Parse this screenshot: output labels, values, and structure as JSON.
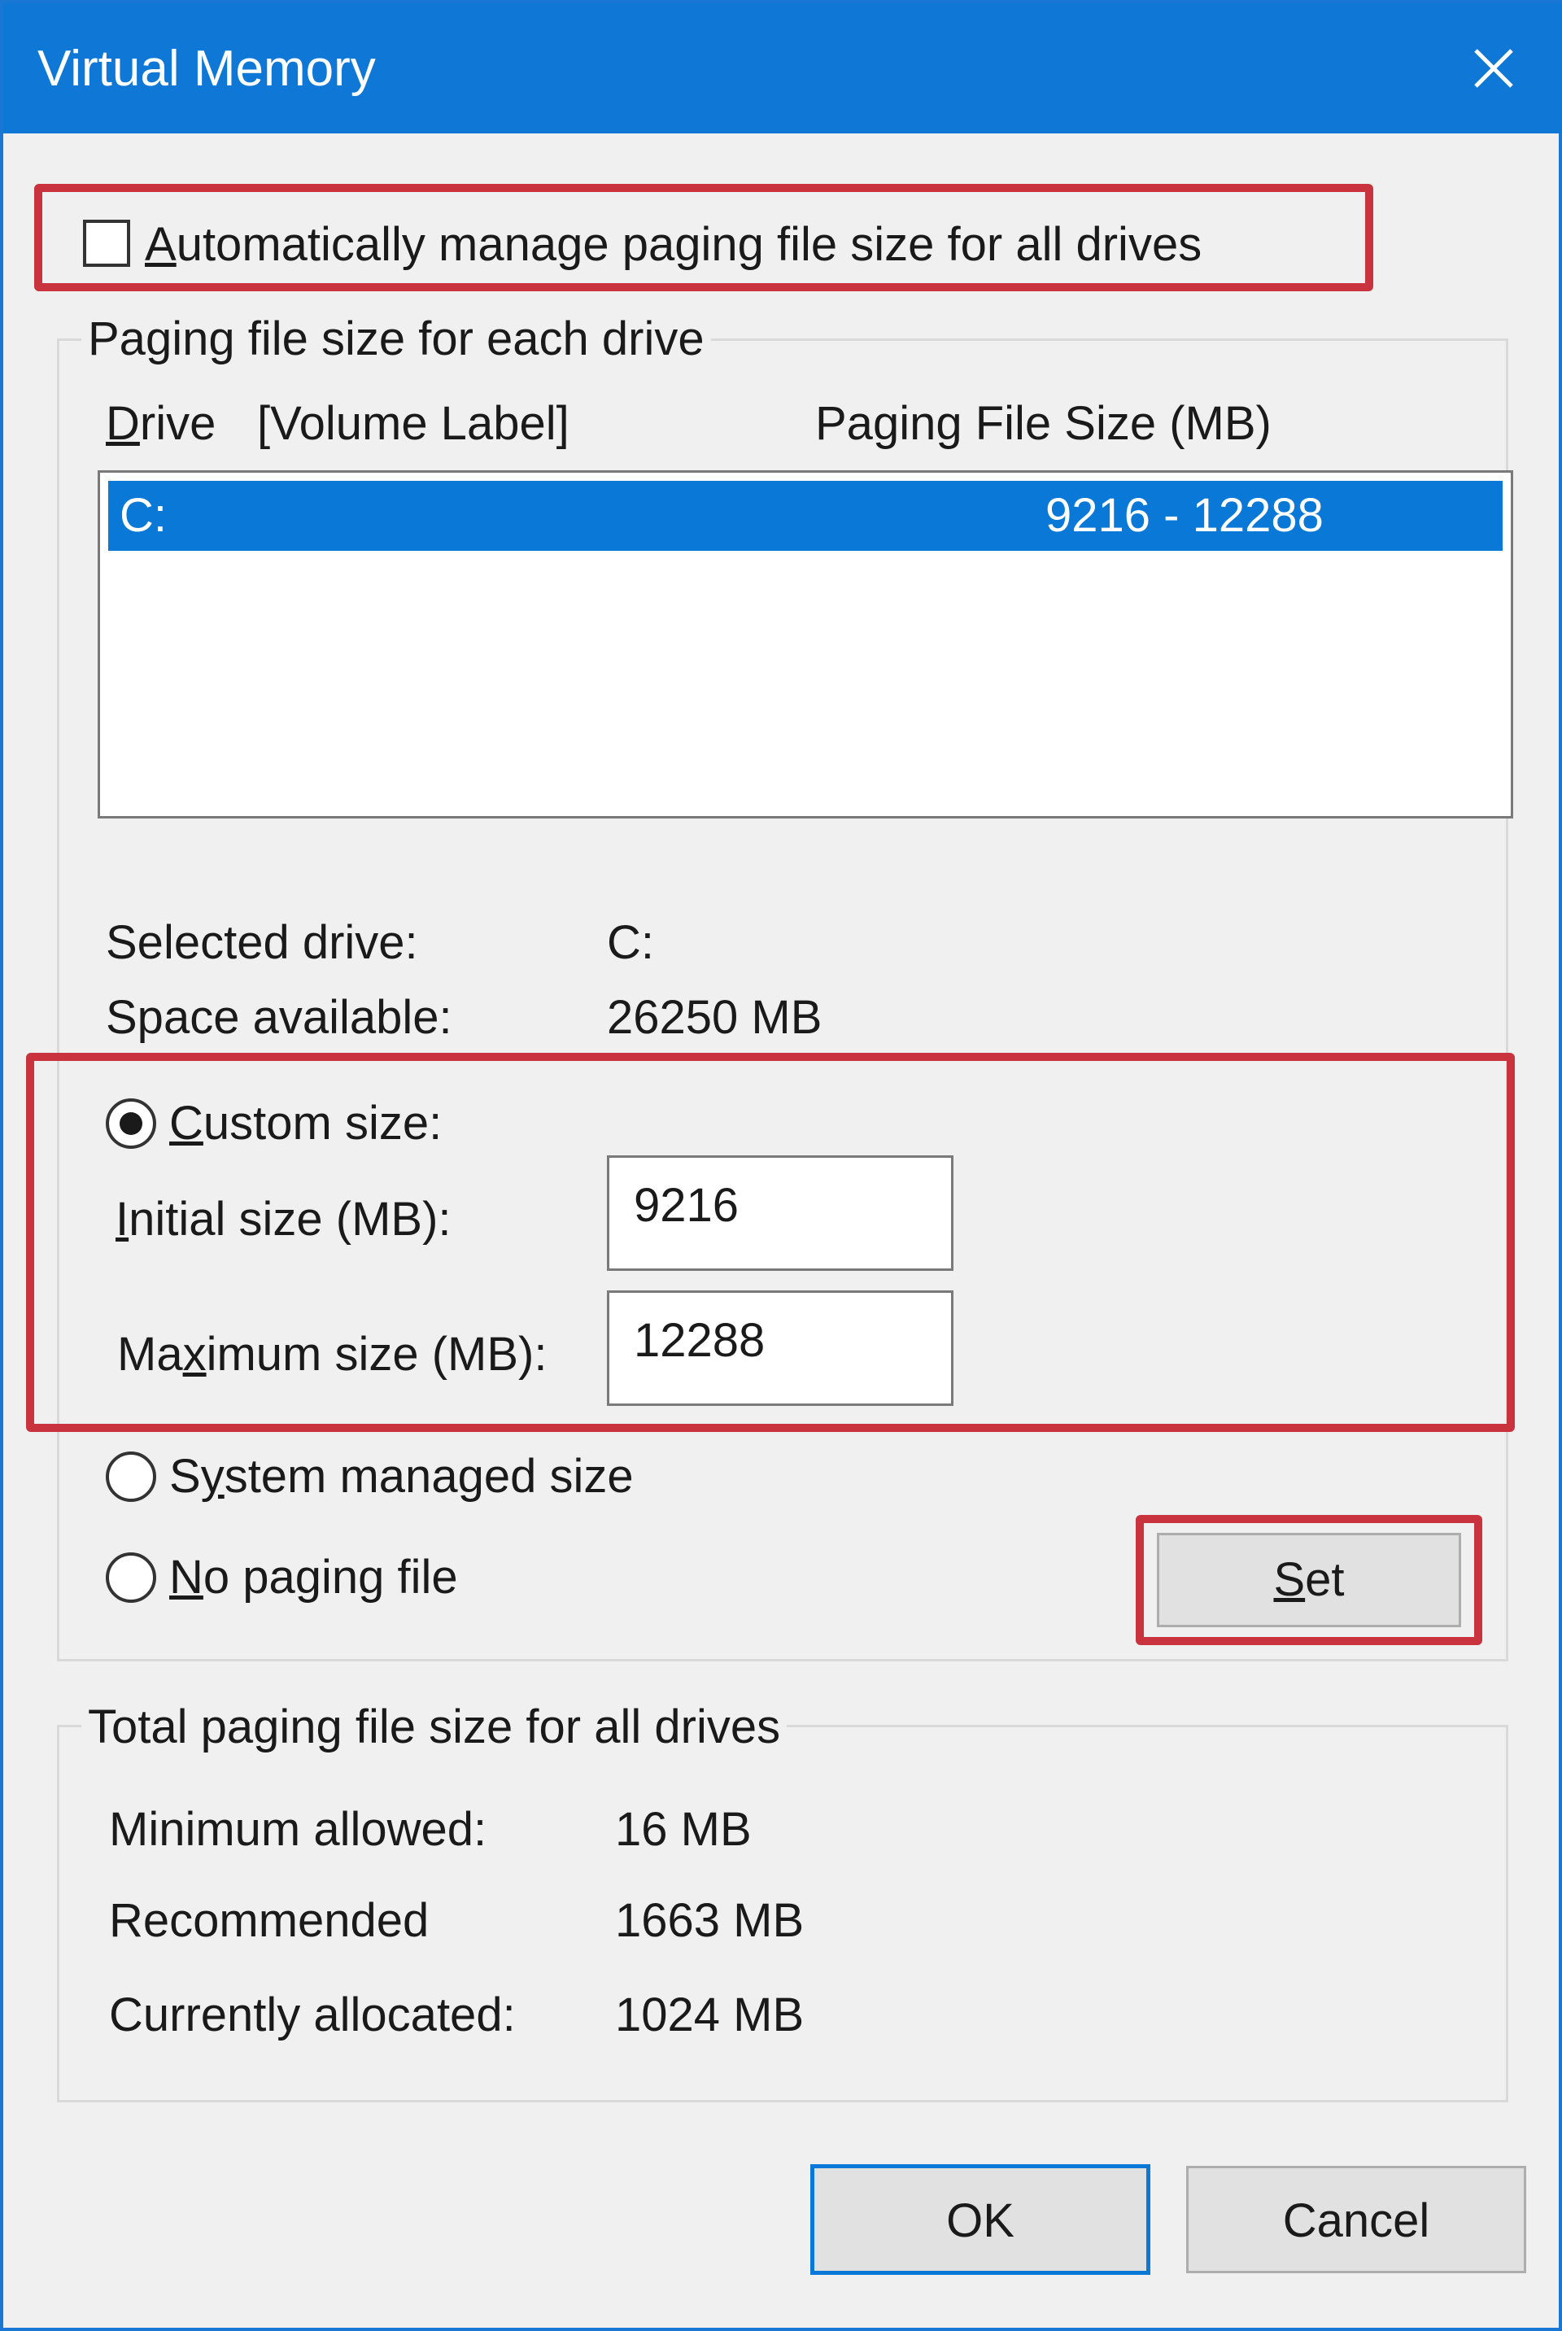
{
  "window": {
    "title": "Virtual Memory",
    "close_icon": "close-icon"
  },
  "auto_manage": {
    "label_prefix": "",
    "label_key": "A",
    "label_rest": "utomatically manage paging file size for all drives",
    "checked": false
  },
  "paging_group": {
    "legend": "Paging file size for each drive",
    "col_drive_key": "D",
    "col_drive_rest": "rive",
    "col_volume": "[Volume Label]",
    "col_size": "Paging File Size (MB)",
    "rows": [
      {
        "drive": "C:",
        "size": "9216 - 12288",
        "selected": true
      }
    ],
    "selected_drive_label": "Selected drive:",
    "selected_drive_value": "C:",
    "space_label": "Space available:",
    "space_value": "26250 MB",
    "custom_label_key": "C",
    "custom_label_rest": "ustom size:",
    "initial_label_key": "I",
    "initial_label_rest": "nitial size (MB):",
    "initial_value": "9216",
    "max_label_pre": "Ma",
    "max_label_key": "x",
    "max_label_rest": "imum size (MB):",
    "max_value": "12288",
    "system_label_pre": "S",
    "system_label_key": "y",
    "system_label_rest": "stem managed size",
    "nopaging_label_key": "N",
    "nopaging_label_rest": "o paging file",
    "set_key": "S",
    "set_rest": "et",
    "selected_option": "custom"
  },
  "total_group": {
    "legend": "Total paging file size for all drives",
    "min_label": "Minimum allowed:",
    "min_value": "16 MB",
    "rec_label": "Recommended",
    "rec_value": "1663 MB",
    "cur_label": "Currently allocated:",
    "cur_value": "1024 MB"
  },
  "buttons": {
    "ok": "OK",
    "cancel": "Cancel"
  },
  "colors": {
    "titlebar": "#0f78d7",
    "highlight_box": "#c8333d",
    "selection": "#0a78d7"
  }
}
